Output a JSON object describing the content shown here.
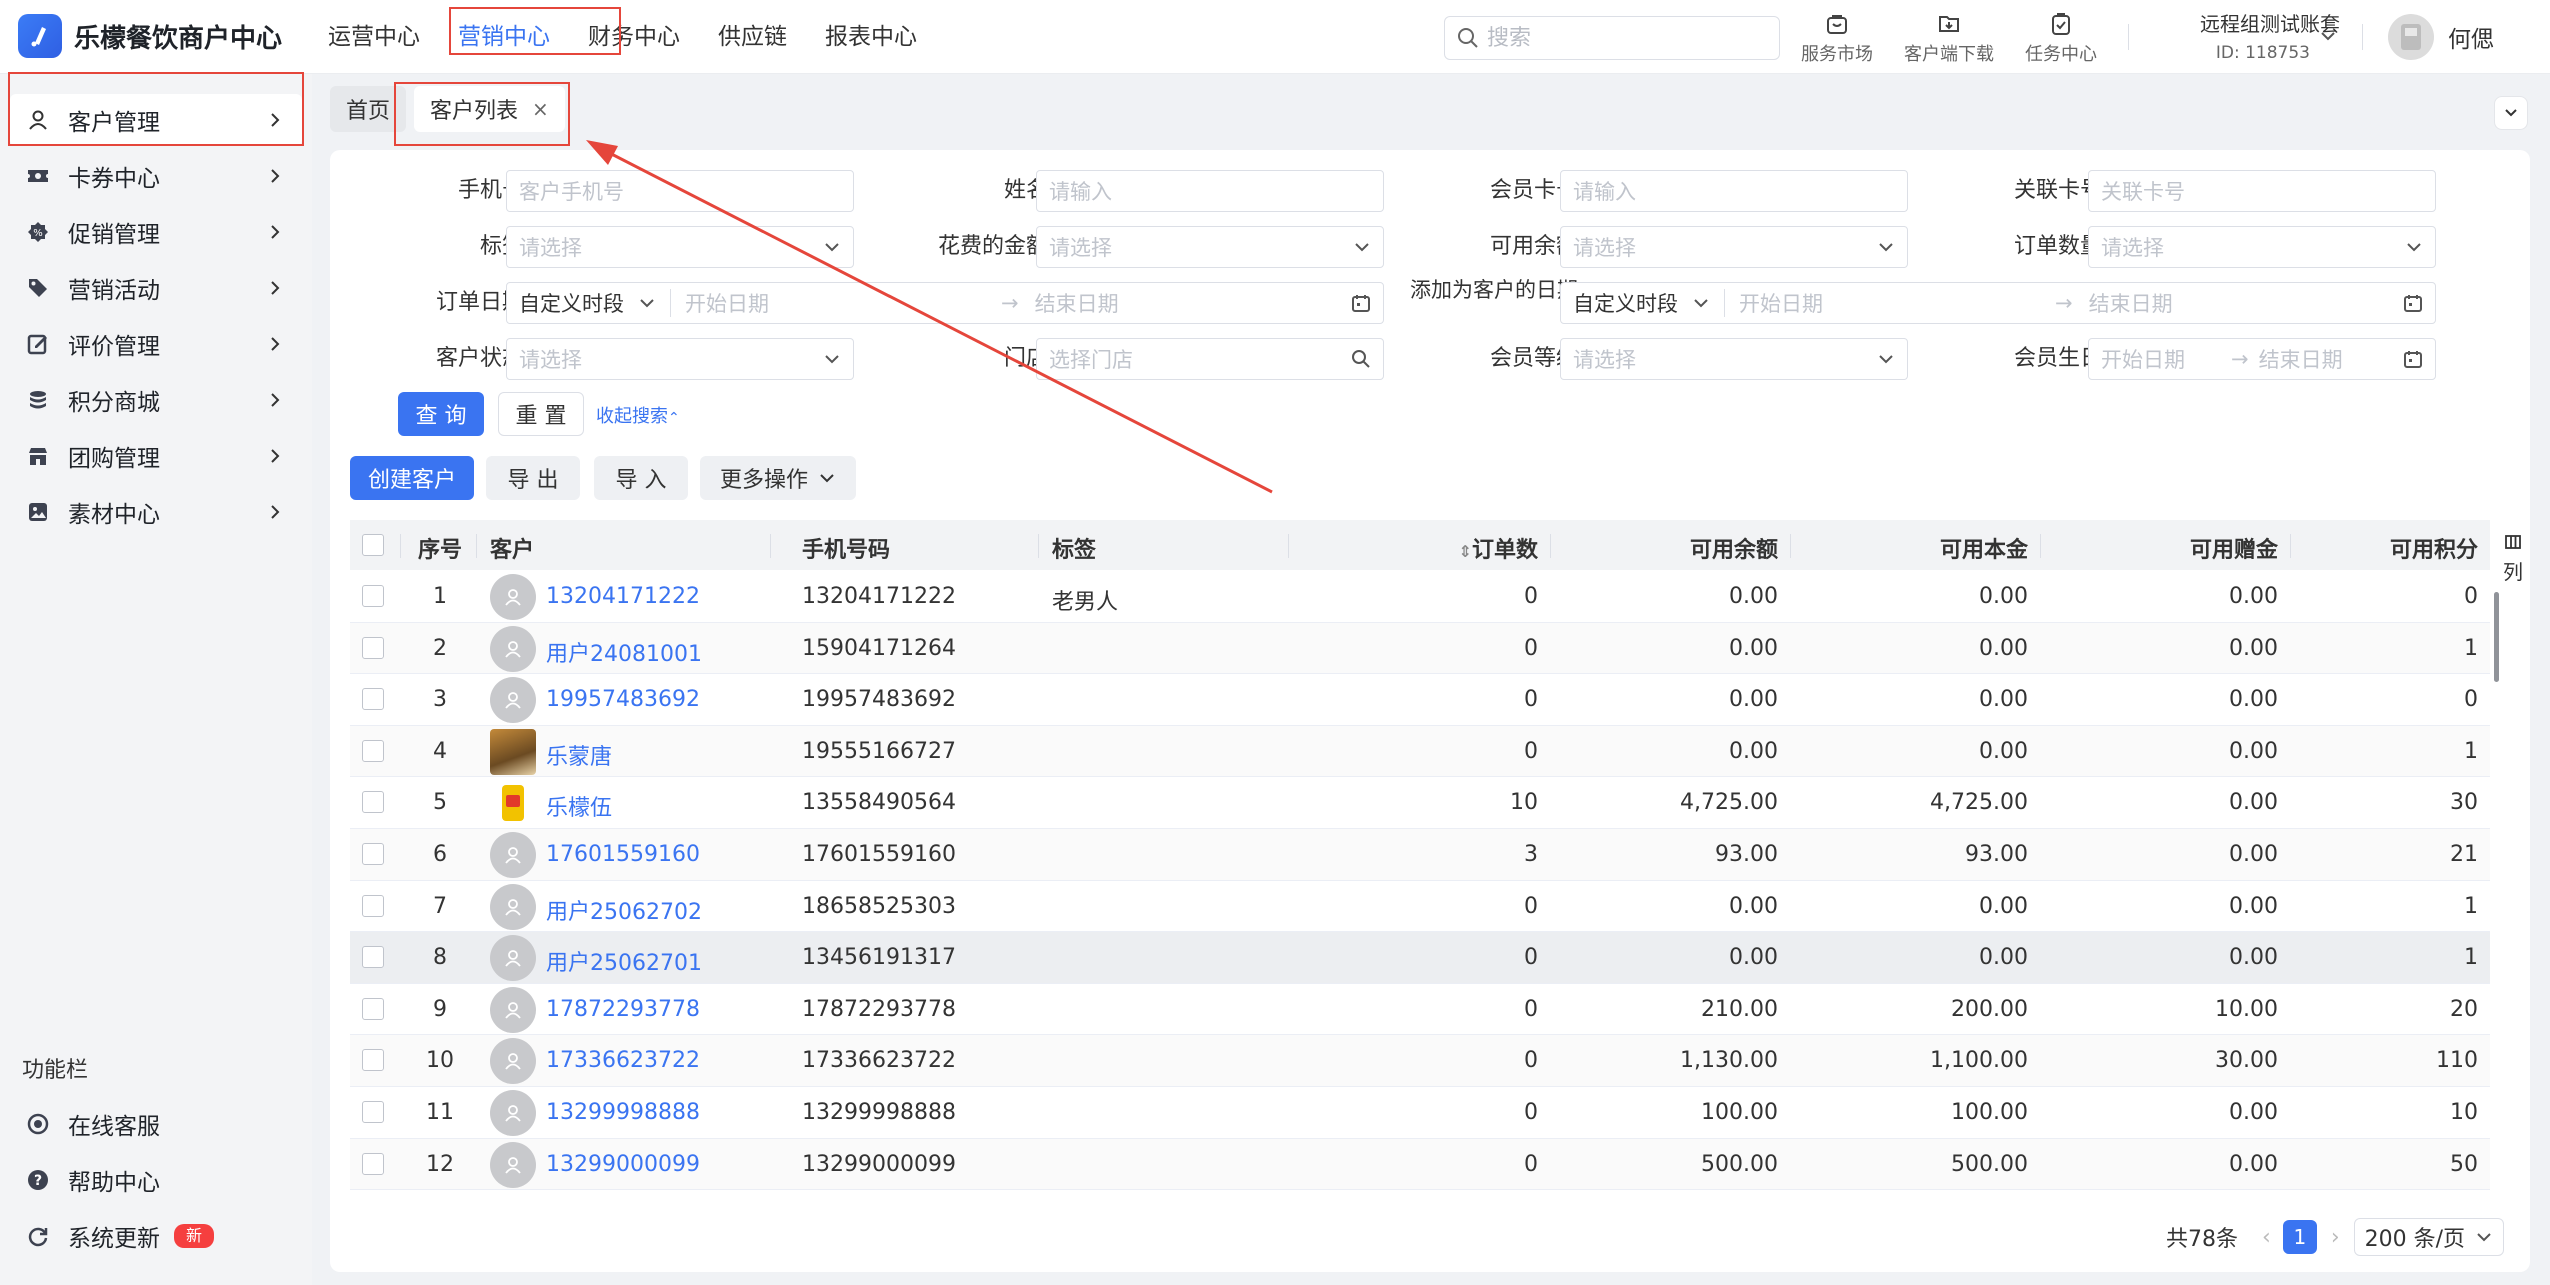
{
  "app": {
    "name": "乐檬餐饮商户中心",
    "brand_color": "#3a74f1"
  },
  "topnav": [
    {
      "label": "运营中心",
      "active": false
    },
    {
      "label": "营销中心",
      "active": true
    },
    {
      "label": "财务中心",
      "active": false
    },
    {
      "label": "供应链",
      "active": false
    },
    {
      "label": "报表中心",
      "active": false
    }
  ],
  "search": {
    "placeholder": "搜索",
    "value": ""
  },
  "tools": [
    {
      "label": "服务市场",
      "icon": "store-icon"
    },
    {
      "label": "客户端下载",
      "icon": "download-icon"
    },
    {
      "label": "任务中心",
      "icon": "task-icon"
    }
  ],
  "account": {
    "name": "远程组测试账套",
    "id": "ID: 118753"
  },
  "user": {
    "name": "何偲"
  },
  "sidebar": {
    "items": [
      {
        "label": "客户管理",
        "icon": "user-icon",
        "active": true
      },
      {
        "label": "卡券中心",
        "icon": "ticket-icon"
      },
      {
        "label": "促销管理",
        "icon": "promo-icon"
      },
      {
        "label": "营销活动",
        "icon": "tag-icon"
      },
      {
        "label": "评价管理",
        "icon": "review-icon"
      },
      {
        "label": "积分商城",
        "icon": "points-icon"
      },
      {
        "label": "团购管理",
        "icon": "shop-icon"
      },
      {
        "label": "素材中心",
        "icon": "image-icon"
      }
    ],
    "section_title": "功能栏",
    "footer": [
      {
        "label": "在线客服",
        "icon": "service-icon"
      },
      {
        "label": "帮助中心",
        "icon": "help-icon"
      },
      {
        "label": "系统更新",
        "icon": "refresh-icon",
        "badge": "新"
      }
    ]
  },
  "tabs": [
    {
      "label": "首页",
      "active": false
    },
    {
      "label": "客户列表",
      "active": true,
      "closable": true,
      "close_glyph": "×"
    }
  ],
  "filters": {
    "phone": {
      "label": "手机号",
      "placeholder": "客户手机号"
    },
    "name": {
      "label": "姓名",
      "placeholder": "请输入"
    },
    "member_card": {
      "label": "会员卡号",
      "placeholder": "请输入"
    },
    "linked_card": {
      "label": "关联卡号",
      "placeholder": "关联卡号"
    },
    "tag": {
      "label": "标签",
      "placeholder": "请选择"
    },
    "spent": {
      "label": "花费的金额",
      "placeholder": "请选择"
    },
    "balance": {
      "label": "可用余额",
      "placeholder": "请选择"
    },
    "order_count": {
      "label": "订单数量",
      "placeholder": "请选择"
    },
    "order_date": {
      "label": "订单日期",
      "mode": "自定义时段",
      "start": "开始日期",
      "end": "结束日期"
    },
    "added_date": {
      "label": "添加为客户的日期",
      "mode": "自定义时段",
      "start": "开始日期",
      "end": "结束日期"
    },
    "status": {
      "label": "客户状态",
      "placeholder": "请选择"
    },
    "store": {
      "label": "门店",
      "placeholder": "选择门店"
    },
    "level": {
      "label": "会员等级",
      "placeholder": "请选择"
    },
    "birthday": {
      "label": "会员生日",
      "start": "开始日期",
      "end": "结束日期"
    }
  },
  "actions": {
    "query": "查 询",
    "reset": "重 置",
    "collapse": "收起搜索",
    "create": "创建客户",
    "export": "导 出",
    "import": "导 入",
    "more": "更多操作"
  },
  "table": {
    "columns": [
      "序号",
      "客户",
      "手机号码",
      "标签",
      "订单数",
      "可用余额",
      "可用本金",
      "可用赠金",
      "可用积分"
    ],
    "column_setting": "列",
    "rows": [
      {
        "no": "1",
        "customer": "13204171222",
        "phone": "13204171222",
        "tag": "老男人",
        "orders": "0",
        "balance": "0.00",
        "principal": "0.00",
        "bonus": "0.00",
        "points": "0",
        "avatar": "default"
      },
      {
        "no": "2",
        "customer": "用户24081001",
        "phone": "15904171264",
        "tag": "",
        "orders": "0",
        "balance": "0.00",
        "principal": "0.00",
        "bonus": "0.00",
        "points": "1",
        "avatar": "default"
      },
      {
        "no": "3",
        "customer": "19957483692",
        "phone": "19957483692",
        "tag": "",
        "orders": "0",
        "balance": "0.00",
        "principal": "0.00",
        "bonus": "0.00",
        "points": "0",
        "avatar": "default"
      },
      {
        "no": "4",
        "customer": "乐蒙唐",
        "phone": "19555166727",
        "tag": "",
        "orders": "0",
        "balance": "0.00",
        "principal": "0.00",
        "bonus": "0.00",
        "points": "1",
        "avatar": "photo-animal"
      },
      {
        "no": "5",
        "customer": "乐檬伍",
        "phone": "13558490564",
        "tag": "",
        "orders": "10",
        "balance": "4,725.00",
        "principal": "4,725.00",
        "bonus": "0.00",
        "points": "30",
        "avatar": "photo-snack"
      },
      {
        "no": "6",
        "customer": "17601559160",
        "phone": "17601559160",
        "tag": "",
        "orders": "3",
        "balance": "93.00",
        "principal": "93.00",
        "bonus": "0.00",
        "points": "21",
        "avatar": "default"
      },
      {
        "no": "7",
        "customer": "用户25062702",
        "phone": "18658525303",
        "tag": "",
        "orders": "0",
        "balance": "0.00",
        "principal": "0.00",
        "bonus": "0.00",
        "points": "1",
        "avatar": "default"
      },
      {
        "no": "8",
        "customer": "用户25062701",
        "phone": "13456191317",
        "tag": "",
        "orders": "0",
        "balance": "0.00",
        "principal": "0.00",
        "bonus": "0.00",
        "points": "1",
        "avatar": "default"
      },
      {
        "no": "9",
        "customer": "17872293778",
        "phone": "17872293778",
        "tag": "",
        "orders": "0",
        "balance": "210.00",
        "principal": "200.00",
        "bonus": "10.00",
        "points": "20",
        "avatar": "default"
      },
      {
        "no": "10",
        "customer": "17336623722",
        "phone": "17336623722",
        "tag": "",
        "orders": "0",
        "balance": "1,130.00",
        "principal": "1,100.00",
        "bonus": "30.00",
        "points": "110",
        "avatar": "default"
      },
      {
        "no": "11",
        "customer": "13299998888",
        "phone": "13299998888",
        "tag": "",
        "orders": "0",
        "balance": "100.00",
        "principal": "100.00",
        "bonus": "0.00",
        "points": "10",
        "avatar": "default"
      },
      {
        "no": "12",
        "customer": "13299000099",
        "phone": "13299000099",
        "tag": "",
        "orders": "0",
        "balance": "500.00",
        "principal": "500.00",
        "bonus": "0.00",
        "points": "50",
        "avatar": "default"
      }
    ]
  },
  "pagination": {
    "total": "共78条",
    "current": "1",
    "page_size": "200 条/页"
  },
  "annotation_color": "#e5463b"
}
